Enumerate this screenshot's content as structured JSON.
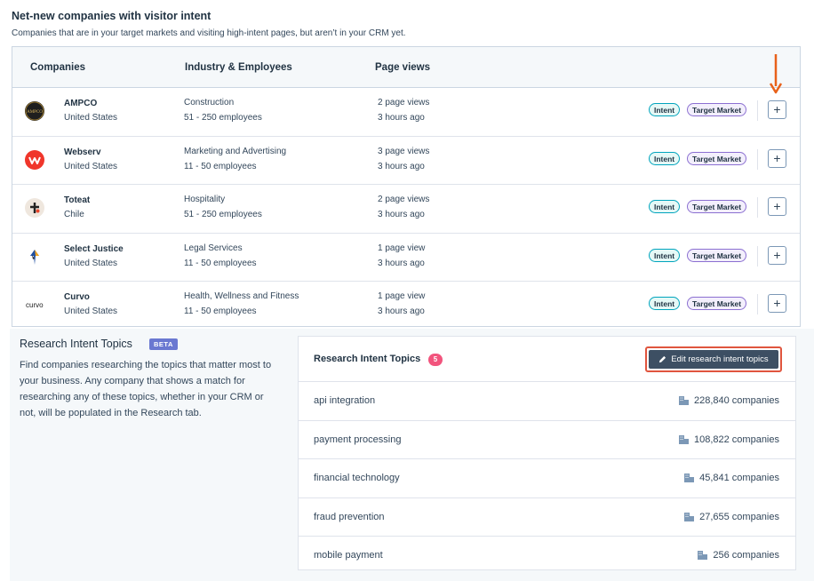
{
  "header": {
    "title": "Net-new companies with visitor intent",
    "subtitle": "Companies that are in your target markets and visiting high-intent pages, but aren’t in your CRM yet."
  },
  "table": {
    "columns": [
      "Companies",
      "Industry & Employees",
      "Page views"
    ],
    "rows": [
      {
        "name": "AMPCO",
        "country": "United States",
        "industry": "Construction",
        "employees": "51 - 250 employees",
        "page_views": "2 page views",
        "last_seen": "3 hours ago",
        "tag_intent": "Intent",
        "tag_target": "Target Market",
        "add_label": "+",
        "logo_icon": "ampco-logo-icon",
        "logo_text": "AMPCO"
      },
      {
        "name": "Webserv",
        "country": "United States",
        "industry": "Marketing and Advertising",
        "employees": "11 - 50 employees",
        "page_views": "3 page views",
        "last_seen": "3 hours ago",
        "tag_intent": "Intent",
        "tag_target": "Target Market",
        "add_label": "+",
        "logo_icon": "webserv-logo-icon"
      },
      {
        "name": "Toteat",
        "country": "Chile",
        "industry": "Hospitality",
        "employees": "51 - 250 employees",
        "page_views": "2 page views",
        "last_seen": "3 hours ago",
        "tag_intent": "Intent",
        "tag_target": "Target Market",
        "add_label": "+",
        "logo_icon": "toteat-logo-icon"
      },
      {
        "name": "Select Justice",
        "country": "United States",
        "industry": "Legal Services",
        "employees": "11 - 50 employees",
        "page_views": "1 page view",
        "last_seen": "3 hours ago",
        "tag_intent": "Intent",
        "tag_target": "Target Market",
        "add_label": "+",
        "logo_icon": "select-justice-logo-icon"
      },
      {
        "name": "Curvo",
        "country": "United States",
        "industry": "Health, Wellness and Fitness",
        "employees": "11 - 50 employees",
        "page_views": "1 page view",
        "last_seen": "3 hours ago",
        "tag_intent": "Intent",
        "tag_target": "Target Market",
        "add_label": "+",
        "logo_icon": "curvo-logo-icon",
        "logo_text": "curvo"
      }
    ]
  },
  "research": {
    "title": "Research Intent Topics",
    "beta": "BETA",
    "description": "Find companies researching the topics that matter most to your business. Any company that shows a match for researching any of these topics, whether in your CRM or not, will be populated in the Research tab."
  },
  "topics_card": {
    "title": "Research Intent Topics",
    "count": "5",
    "edit_button": "Edit research intent topics",
    "topics": [
      {
        "name": "api integration",
        "companies": "228,840 companies"
      },
      {
        "name": "payment processing",
        "companies": "108,822 companies"
      },
      {
        "name": "financial technology",
        "companies": "45,841 companies"
      },
      {
        "name": "fraud prevention",
        "companies": "27,655 companies"
      },
      {
        "name": "mobile payment",
        "companies": "256 companies"
      }
    ]
  },
  "colors": {
    "accent_arrow": "#e8611a",
    "highlight_border": "#e0553e",
    "count_badge": "#f2547d",
    "beta_badge": "#6a78d1",
    "intent_tag": "#00a4bd",
    "target_tag": "#8b6fd1"
  }
}
